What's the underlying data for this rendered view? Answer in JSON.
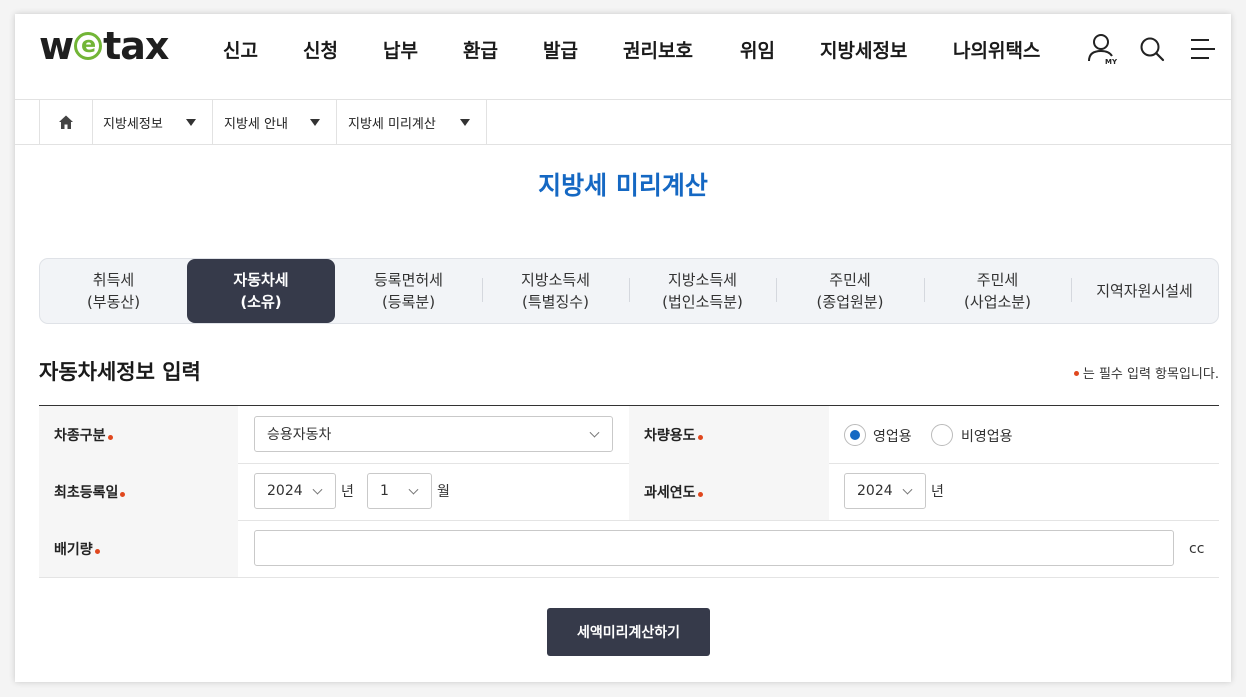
{
  "header": {
    "logo": {
      "w": "w",
      "e": "e",
      "rest": "tax"
    },
    "menu": [
      "신고",
      "신청",
      "납부",
      "환급",
      "발급",
      "권리보호",
      "위임",
      "지방세정보",
      "나의위택스"
    ],
    "icons": {
      "my_label": "MY"
    }
  },
  "breadcrumb": {
    "items": [
      "지방세정보",
      "지방세 안내",
      "지방세 미리계산"
    ]
  },
  "page_title": "지방세 미리계산",
  "tabs": [
    {
      "label": "취득세\n(부동산)"
    },
    {
      "label": "자동차세\n(소유)"
    },
    {
      "label": "등록면허세\n(등록분)"
    },
    {
      "label": "지방소득세\n(특별징수)"
    },
    {
      "label": "지방소득세\n(법인소득분)"
    },
    {
      "label": "주민세\n(종업원분)"
    },
    {
      "label": "주민세\n(사업소분)"
    },
    {
      "label": "지역자원시설세"
    }
  ],
  "section": {
    "title": "자동차세정보 입력",
    "required_note": "는 필수 입력 항목입니다."
  },
  "form": {
    "vehicle_type_label": "차종구분",
    "vehicle_type_value": "승용자동차",
    "usage_label": "차량용도",
    "usage_options": [
      "영업용",
      "비영업용"
    ],
    "usage_selected": "영업용",
    "first_reg_label": "최초등록일",
    "first_reg_year": "2024",
    "year_unit": "년",
    "first_reg_month": "1",
    "month_unit": "월",
    "tax_year_label": "과세연도",
    "tax_year_value": "2024",
    "displacement_label": "배기량",
    "displacement_value": "",
    "displacement_unit": "cc"
  },
  "submit_label": "세액미리계산하기",
  "colors": {
    "accent": "#1568c3",
    "dark": "#363a4a",
    "required": "#e0481e",
    "logo_green": "#72b536"
  }
}
